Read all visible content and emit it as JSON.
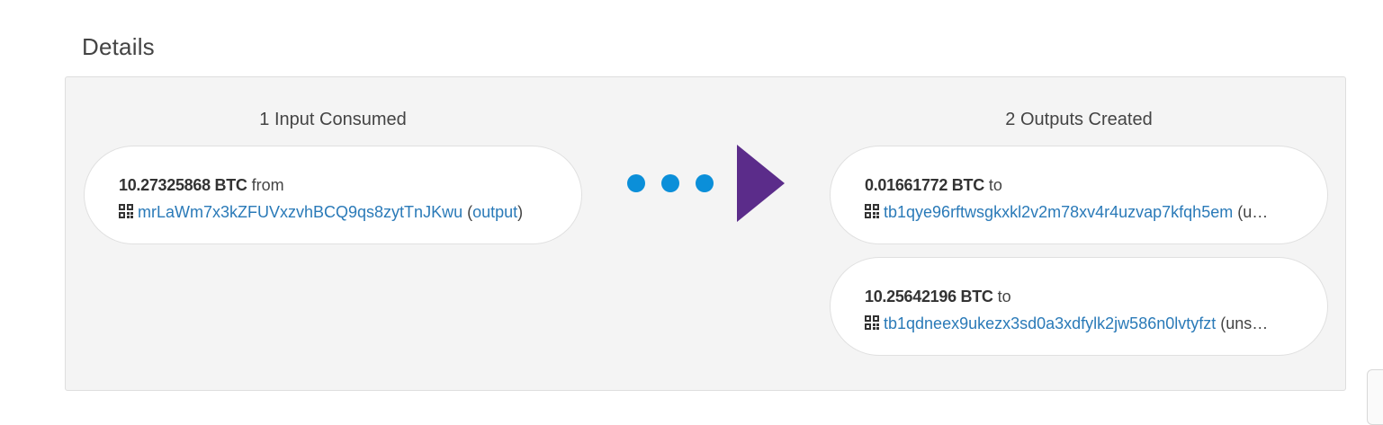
{
  "section": {
    "title": "Details"
  },
  "inputs": {
    "heading": "1 Input Consumed",
    "items": [
      {
        "amount": "10.27325868 BTC",
        "connector": "from",
        "address": "mrLaWm7x3kZFUVxzvhBCQ9qs8zytTnJKwu",
        "status": "output"
      }
    ]
  },
  "outputs": {
    "heading": "2 Outputs Created",
    "items": [
      {
        "amount": "0.01661772 BTC",
        "connector": "to",
        "address": "tb1qye96rftwsgkxkl2v2m78xv4r4uzvap7kfqh5em",
        "status_truncated": "(u…"
      },
      {
        "amount": "10.25642196 BTC",
        "connector": "to",
        "address": "tb1qdneex9ukezx3sd0a3xdfylk2jw586n0lvtyfzt",
        "status_truncated": "(uns…"
      }
    ]
  },
  "icons": {
    "address": "qr-code-icon",
    "flow_dots": "flow-dots-icon",
    "flow_arrow": "play-arrow-icon"
  },
  "colors": {
    "link": "#2a7ab8",
    "dots": "#0b8fd9",
    "arrow": "#5b2c8a",
    "panel_bg": "#f4f4f4"
  }
}
